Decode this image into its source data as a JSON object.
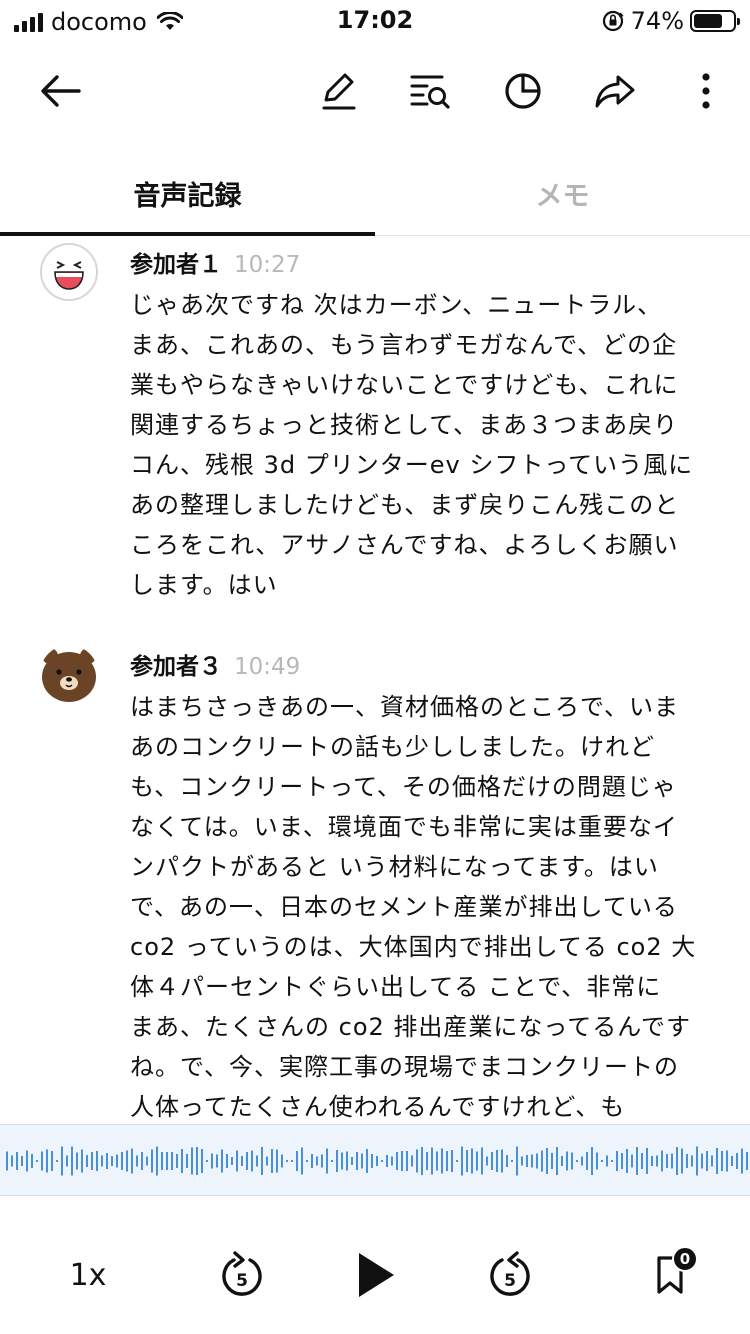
{
  "status_bar": {
    "carrier": "docomo",
    "time": "17:02",
    "battery_percent": "74%",
    "battery_level": 0.74
  },
  "toolbar": {
    "icons": [
      "back-arrow-icon",
      "edit-pencil-icon",
      "search-list-icon",
      "pie-chart-icon",
      "share-arrow-icon",
      "more-vertical-icon"
    ]
  },
  "tabs": [
    {
      "label": "音声記録",
      "active": true
    },
    {
      "label": "メモ",
      "active": false
    }
  ],
  "transcript": [
    {
      "speaker": "参加者１",
      "time": "10:27",
      "avatar": "laughing-face-icon",
      "lines": [
        "じゃあ次ですね 次はカーボン、ニュートラル、",
        "まあ、これあの、もう言わずモガなんで、どの企",
        "業もやらなきゃいけないことですけども、これに",
        "関連するちょっと技術として、まあ３つまあ戻り",
        "コん、残根 3d プリンターev シフトっていう風に",
        "あの整理しましたけども、まず戻りこん残このと",
        "ころをこれ、アサノさんですね、よろしくお願い",
        "します。はい"
      ]
    },
    {
      "speaker": "参加者３",
      "time": "10:49",
      "avatar": "brown-bear-icon",
      "lines": [
        "はまちさっきあの一、資材価格のところで、いま",
        "あのコンクリートの話も少ししました。けれど",
        "も、コンクリートって、その価格だけの問題じゃ",
        "なくては。いま、環境面でも非常に実は重要なイ",
        "ンパクトがあると いう材料になってます。はい",
        "で、あの一、日本のセメント産業が排出している",
        "co2 っていうのは、大体国内で排出してる co2 大",
        "体４パーセントぐらい出してる ことで、非常に",
        "まあ、たくさんの co2 排出産業になってるんです",
        "ね。で、今、実際工事の現場でまコンクリートの",
        "人体ってたくさん使われるんですけれど、も"
      ]
    }
  ],
  "waveform": {
    "color": "#4a90d9",
    "background": "#eef4fb"
  },
  "player": {
    "speed": "1x",
    "rewind_seconds": "5",
    "forward_seconds": "5",
    "bookmark_count": "0",
    "icons": [
      "rewind-5-icon",
      "play-icon",
      "forward-5-icon",
      "bookmark-icon"
    ]
  }
}
